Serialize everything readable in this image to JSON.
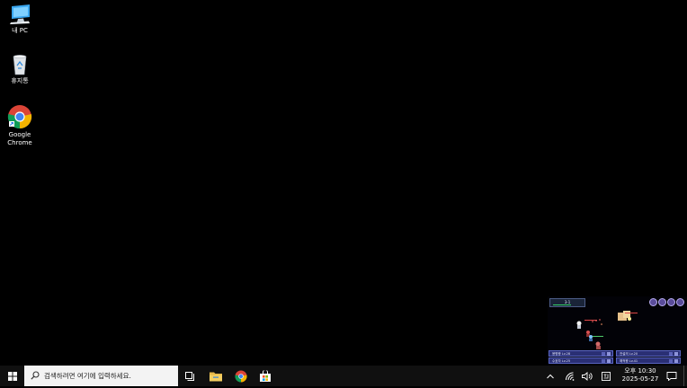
{
  "desktop": {
    "icons": [
      {
        "label": "내 PC",
        "icon": "monitor-icon"
      },
      {
        "label": "휴지통",
        "icon": "recycle-bin-icon"
      },
      {
        "label": "Google Chrome",
        "icon": "chrome-icon"
      }
    ]
  },
  "game_overlay": {
    "stage_label": "3-1",
    "buttons": [
      "",
      "",
      ""
    ],
    "panels": [
      {
        "label": "용병왕 Lv.28"
      },
      {
        "label": "전설의 Lv.20"
      },
      {
        "label": "수호자 Lv.25"
      },
      {
        "label": "해적왕 Lv.41"
      }
    ]
  },
  "taskbar": {
    "search_placeholder": "검색하려면 여기에 입력하세요.",
    "time": "오후 10:30",
    "date": "2025-05-27"
  },
  "colors": {
    "taskbar_bg": "#101010",
    "search_bg": "#f3f3f3",
    "accent_blue": "#0078d7"
  }
}
